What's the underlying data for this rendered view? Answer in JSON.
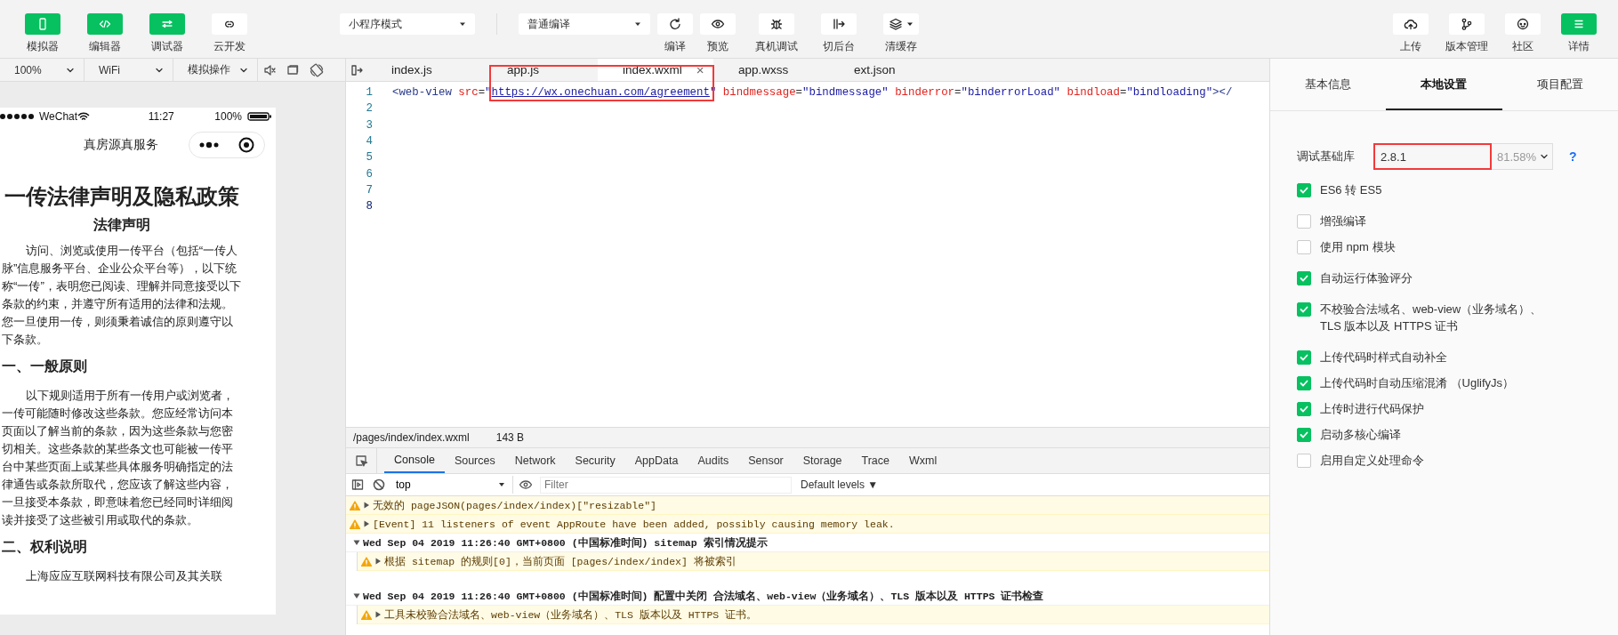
{
  "toolbar": {
    "left": [
      {
        "label": "模拟器",
        "on": true
      },
      {
        "label": "编辑器",
        "on": true
      },
      {
        "label": "调试器",
        "on": true
      },
      {
        "label": "云开发",
        "on": false
      }
    ],
    "mode_select": {
      "value": "小程序模式"
    },
    "compile_select": {
      "value": "普通编译"
    },
    "center": [
      {
        "label": "编译"
      },
      {
        "label": "预览"
      },
      {
        "label": "真机调试"
      },
      {
        "label": "切后台"
      },
      {
        "label": "清缓存"
      }
    ],
    "right": [
      {
        "label": "上传",
        "on": false
      },
      {
        "label": "版本管理",
        "on": false
      },
      {
        "label": "社区",
        "on": false
      },
      {
        "label": "详情",
        "on": true
      }
    ]
  },
  "simulator_bar": {
    "zoom": "100%",
    "network": "WiFi",
    "operation": "模拟操作"
  },
  "simulator": {
    "status": {
      "carrier": "WeChat",
      "time": "11:27",
      "battery": "100%"
    },
    "nav_title": "真房源真服务",
    "page": [
      {
        "kind": "title",
        "text": "一传法律声明及隐私政策"
      },
      {
        "kind": "subtitle",
        "text": "法律声明"
      },
      {
        "kind": "paragraph",
        "text": "访问、浏览或使用一传平台（包括“一传人脉”信息服务平台、企业公众平台等），以下统称“一传”，表明您已阅读、理解并同意接受以下条款的约束，并遵守所有适用的法律和法规。您一旦使用一传，则须秉着诚信的原则遵守以下条款。"
      },
      {
        "kind": "heading",
        "text": "一、一般原则"
      },
      {
        "kind": "paragraph",
        "text": "以下规则适用于所有一传用户或浏览者，一传可能随时修改这些条款。您应经常访问本页面以了解当前的条款，因为这些条款与您密切相关。这些条款的某些条文也可能被一传平台中某些页面上或某些具体服务明确指定的法律通告或条款所取代，您应该了解这些内容，一旦接受本条款，即意味着您已经同时详细阅读并接受了这些被引用或取代的条款。"
      },
      {
        "kind": "heading",
        "text": "二、权利说明"
      },
      {
        "kind": "paragraph",
        "text": "上海应应互联网科技有限公司及其关联"
      }
    ]
  },
  "editor": {
    "tabs": [
      {
        "label": "index.js",
        "selected": false
      },
      {
        "label": "app.js",
        "selected": false
      },
      {
        "label": "index.wxml",
        "selected": true,
        "close": "×"
      },
      {
        "label": "app.wxss",
        "selected": false
      },
      {
        "label": "ext.json",
        "selected": false
      }
    ],
    "lines": [
      {
        "number": "1",
        "current": false,
        "tokens": [
          {
            "kind": "tag",
            "text": "<web-view"
          },
          {
            "kind": "attr",
            "text": " src"
          },
          {
            "kind": "punct",
            "text": "="
          },
          {
            "kind": "string",
            "text": "\""
          },
          {
            "kind": "link",
            "text": "https://wx.onechuan.com/agreement",
            "highlighted": true
          },
          {
            "kind": "string",
            "text": "\""
          },
          {
            "kind": "attr",
            "text": " bindmessage"
          },
          {
            "kind": "punct",
            "text": "="
          },
          {
            "kind": "string",
            "text": "\"bindmessage\""
          },
          {
            "kind": "attr",
            "text": " binderror"
          },
          {
            "kind": "punct",
            "text": "="
          },
          {
            "kind": "string",
            "text": "\"binderrorLoad\""
          },
          {
            "kind": "attr",
            "text": " bindload"
          },
          {
            "kind": "punct",
            "text": "="
          },
          {
            "kind": "string",
            "text": "\"bindloading\""
          },
          {
            "kind": "tag",
            "text": "></"
          }
        ]
      },
      {
        "number": "2",
        "current": false
      },
      {
        "number": "3",
        "current": false
      },
      {
        "number": "4",
        "current": false
      },
      {
        "number": "5",
        "current": false
      },
      {
        "number": "6",
        "current": false
      },
      {
        "number": "7",
        "current": false
      },
      {
        "number": "8",
        "current": true
      }
    ]
  },
  "file_status": {
    "path": "/pages/index/index.wxml",
    "size": "143 B"
  },
  "devtools": {
    "tabs": [
      {
        "label": "Console",
        "selected": true
      },
      {
        "label": "Sources",
        "selected": false
      },
      {
        "label": "Network",
        "selected": false
      },
      {
        "label": "Security",
        "selected": false
      },
      {
        "label": "AppData",
        "selected": false
      },
      {
        "label": "Audits",
        "selected": false
      },
      {
        "label": "Sensor",
        "selected": false
      },
      {
        "label": "Storage",
        "selected": false
      },
      {
        "label": "Trace",
        "selected": false
      },
      {
        "label": "Wxml",
        "selected": false
      }
    ],
    "context": "top",
    "filter": {
      "placeholder": "Filter"
    },
    "levels": "Default levels ▼",
    "messages": [
      {
        "kind": "warn",
        "expanded": false,
        "text": "无效的 pageJSON(pages/index/index)[\"resizable\"]"
      },
      {
        "kind": "warn",
        "expanded": false,
        "text": "[Event] 11 listeners of event AppRoute have been added, possibly causing memory leak."
      },
      {
        "kind": "group",
        "expanded": true,
        "text": "Wed Sep 04 2019 11:26:40 GMT+0800 (中国标准时间) sitemap 索引情况提示",
        "children": [
          {
            "kind": "warn",
            "expanded": false,
            "text": "根据 sitemap 的规则[0]，当前页面 [pages/index/index] 将被索引"
          }
        ]
      },
      {
        "kind": "group",
        "expanded": true,
        "text": "Wed Sep 04 2019 11:26:40 GMT+0800 (中国标准时间) 配置中关闭 合法域名、web-view（业务域名）、TLS 版本以及 HTTPS 证书检查",
        "children": [
          {
            "kind": "warn",
            "expanded": false,
            "text": "工具未校验合法域名、web-view（业务域名）、TLS 版本以及 HTTPS 证书。"
          }
        ]
      }
    ]
  },
  "settings": {
    "tabs": [
      {
        "label": "基本信息",
        "selected": false
      },
      {
        "label": "本地设置",
        "selected": true
      },
      {
        "label": "项目配置",
        "selected": false
      }
    ],
    "library": {
      "label": "调试基础库",
      "value": "2.8.1",
      "usage": "81.58%",
      "highlighted": true,
      "help": "?"
    },
    "options": [
      {
        "label": "ES6 转 ES5",
        "checked": true
      },
      {
        "label": "增强编译",
        "checked": false
      },
      {
        "label": "使用 npm 模块",
        "checked": false
      },
      {
        "label": "自动运行体验评分",
        "checked": true
      },
      {
        "label": "不校验合法域名、web-view（业务域名）、TLS 版本以及 HTTPS 证书",
        "checked": true
      },
      {
        "label": "上传代码时样式自动补全",
        "checked": true
      },
      {
        "label": "上传代码时自动压缩混淆 （UglifyJs）",
        "checked": true
      },
      {
        "label": "上传时进行代码保护",
        "checked": true
      },
      {
        "label": "启动多核心编译",
        "checked": true
      },
      {
        "label": "启用自定义处理命令",
        "checked": false
      }
    ]
  }
}
